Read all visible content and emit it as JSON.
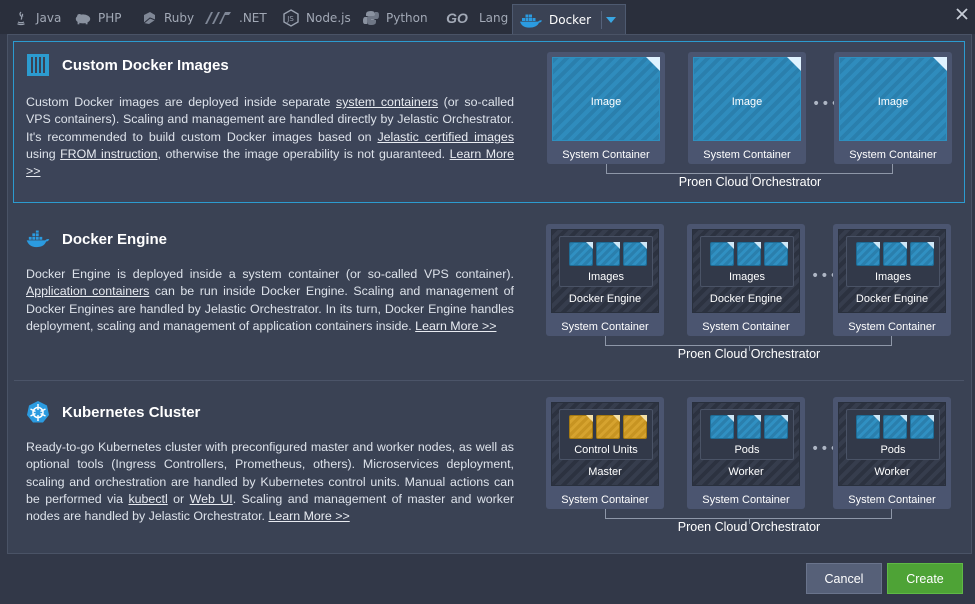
{
  "tabs": [
    {
      "label": "Java",
      "icon": "java-icon"
    },
    {
      "label": "PHP",
      "icon": "php-icon"
    },
    {
      "label": "Ruby",
      "icon": "ruby-icon"
    },
    {
      "label": ".NET",
      "icon": "dotnet-icon"
    },
    {
      "label": "Node.js",
      "icon": "nodejs-icon"
    },
    {
      "label": "Python",
      "icon": "python-icon"
    },
    {
      "label": "Lang",
      "icon": "go-icon",
      "prefix": "GO"
    },
    {
      "label": "Docker",
      "icon": "docker-icon",
      "active": true
    }
  ],
  "sections": {
    "custom": {
      "title": "Custom Docker Images",
      "d1": "Custom Docker images are deployed inside separate ",
      "l1": "system containers",
      "d2": " (or so-called VPS containers). Scaling and management are handled directly by Jelastic Orchestrator. It's recommended to build custom Docker images based on ",
      "l2": "Jelastic certified images",
      "d3": " using ",
      "l3": "FROM instruction",
      "d4": ", otherwise the image operability is not guaranteed. ",
      "learn": "Learn More >>",
      "boxes": [
        {
          "inner": "Image",
          "outer": "System Container"
        },
        {
          "inner": "Image",
          "outer": "System Container"
        },
        {
          "inner": "Image",
          "outer": "System Container"
        }
      ],
      "orchestrator": "Proen Cloud Orchestrator"
    },
    "engine": {
      "title": "Docker Engine",
      "d1": "Docker Engine is deployed inside a system container (or so-called VPS container). ",
      "l1": "Application containers",
      "d2": " can be run inside Docker Engine. Scaling and management of Docker Engines are handled by Jelastic Orchestrator. In its turn, Docker Engine handles deployment, scaling and management of application containers inside. ",
      "learn": "Learn More >>",
      "boxes": [
        {
          "inner": "Images",
          "mid": "Docker Engine",
          "outer": "System Container"
        },
        {
          "inner": "Images",
          "mid": "Docker Engine",
          "outer": "System Container"
        },
        {
          "inner": "Images",
          "mid": "Docker Engine",
          "outer": "System Container"
        }
      ],
      "orchestrator": "Proen Cloud Orchestrator"
    },
    "k8s": {
      "title": "Kubernetes Cluster",
      "d1": "Ready-to-go Kubernetes cluster with preconfigured master and worker nodes, as well as optional tools (Ingress Controllers, Prometheus, others). Microservices deployment, scaling and orchestration are handled by Kubernetes control units. Manual actions can be performed via ",
      "l1": "kubectl",
      "d2": " or ",
      "l2": "Web UI",
      "d3": ". Scaling and management of master and worker nodes are handled by Jelastic Orchestrator. ",
      "learn": "Learn More >>",
      "boxes": [
        {
          "inner": "Control Units",
          "mid": "Master",
          "outer": "System Container",
          "color": "gold"
        },
        {
          "inner": "Pods",
          "mid": "Worker",
          "outer": "System Container",
          "color": "blue"
        },
        {
          "inner": "Pods",
          "mid": "Worker",
          "outer": "System Container",
          "color": "blue"
        }
      ],
      "orchestrator": "Proen Cloud Orchestrator"
    }
  },
  "dots": "•••",
  "footer": {
    "cancel": "Cancel",
    "create": "Create"
  },
  "colors": {
    "accent": "#2c9bcf",
    "create": "#4ea336",
    "gold": "#d6a32f"
  }
}
